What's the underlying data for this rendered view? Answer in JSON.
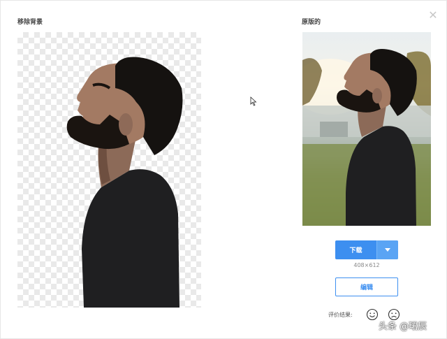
{
  "left_panel": {
    "title": "移除背景"
  },
  "right_panel": {
    "title": "原版的"
  },
  "close_icon": "close-icon",
  "download": {
    "label": "下载",
    "dropdown_icon": "caret-down-icon"
  },
  "dimensions": "408×612",
  "edit": {
    "label": "编辑"
  },
  "rating": {
    "label": "评价结果:",
    "positive_icon": "smile-face-icon",
    "negative_icon": "sad-face-icon"
  },
  "watermark": "头条 @珺辰",
  "colors": {
    "accent": "#3d8ff0",
    "accent_light": "#5aa4f4",
    "checker": "#e9e9e9"
  }
}
